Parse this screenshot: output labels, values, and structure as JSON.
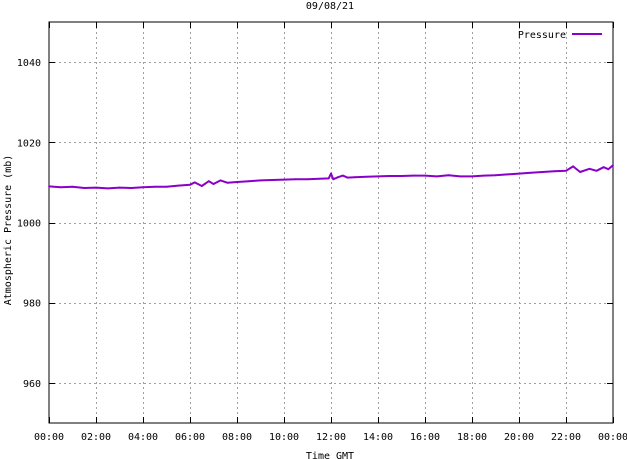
{
  "chart_data": {
    "type": "line",
    "title": "09/08/21",
    "xlabel": "Time GMT",
    "ylabel": "Atmospheric Pressure (mb)",
    "xlim": [
      0,
      24
    ],
    "ylim": [
      950,
      1050
    ],
    "x_ticks": [
      {
        "value": 0,
        "label": "00:00"
      },
      {
        "value": 2,
        "label": "02:00"
      },
      {
        "value": 4,
        "label": "04:00"
      },
      {
        "value": 6,
        "label": "06:00"
      },
      {
        "value": 8,
        "label": "08:00"
      },
      {
        "value": 10,
        "label": "10:00"
      },
      {
        "value": 12,
        "label": "12:00"
      },
      {
        "value": 14,
        "label": "14:00"
      },
      {
        "value": 16,
        "label": "16:00"
      },
      {
        "value": 18,
        "label": "18:00"
      },
      {
        "value": 20,
        "label": "20:00"
      },
      {
        "value": 22,
        "label": "22:00"
      },
      {
        "value": 24,
        "label": "00:00"
      }
    ],
    "y_ticks": [
      {
        "value": 960,
        "label": "960"
      },
      {
        "value": 980,
        "label": "980"
      },
      {
        "value": 1000,
        "label": "1000"
      },
      {
        "value": 1020,
        "label": "1020"
      },
      {
        "value": 1040,
        "label": "1040"
      }
    ],
    "grid": true,
    "legend_position": "top-right",
    "series": [
      {
        "name": "Pressure",
        "color": "#8a00c8",
        "x": [
          0,
          0.5,
          1,
          1.5,
          2,
          2.5,
          3,
          3.5,
          4,
          4.5,
          5,
          5.5,
          6,
          6.2,
          6.5,
          6.8,
          7,
          7.3,
          7.6,
          8,
          8.5,
          9,
          9.5,
          10,
          10.5,
          11,
          11.5,
          11.9,
          12.0,
          12.1,
          12.3,
          12.5,
          12.7,
          13,
          13.5,
          14,
          14.5,
          15,
          15.5,
          16,
          16.5,
          17,
          17.5,
          18,
          18.5,
          19,
          19.5,
          20,
          20.5,
          21,
          21.5,
          22,
          22.3,
          22.6,
          23,
          23.3,
          23.6,
          23.8,
          24
        ],
        "values": [
          1009.0,
          1008.8,
          1008.9,
          1008.6,
          1008.7,
          1008.5,
          1008.7,
          1008.6,
          1008.8,
          1008.9,
          1008.9,
          1009.2,
          1009.4,
          1010.0,
          1009.1,
          1010.3,
          1009.6,
          1010.5,
          1009.9,
          1010.1,
          1010.3,
          1010.5,
          1010.6,
          1010.7,
          1010.8,
          1010.8,
          1010.9,
          1011.0,
          1012.2,
          1010.8,
          1011.3,
          1011.7,
          1011.2,
          1011.3,
          1011.4,
          1011.5,
          1011.6,
          1011.6,
          1011.7,
          1011.7,
          1011.5,
          1011.8,
          1011.5,
          1011.5,
          1011.7,
          1011.8,
          1012.0,
          1012.2,
          1012.4,
          1012.6,
          1012.8,
          1012.9,
          1014.0,
          1012.6,
          1013.4,
          1012.9,
          1013.8,
          1013.3,
          1014.3
        ]
      }
    ]
  }
}
